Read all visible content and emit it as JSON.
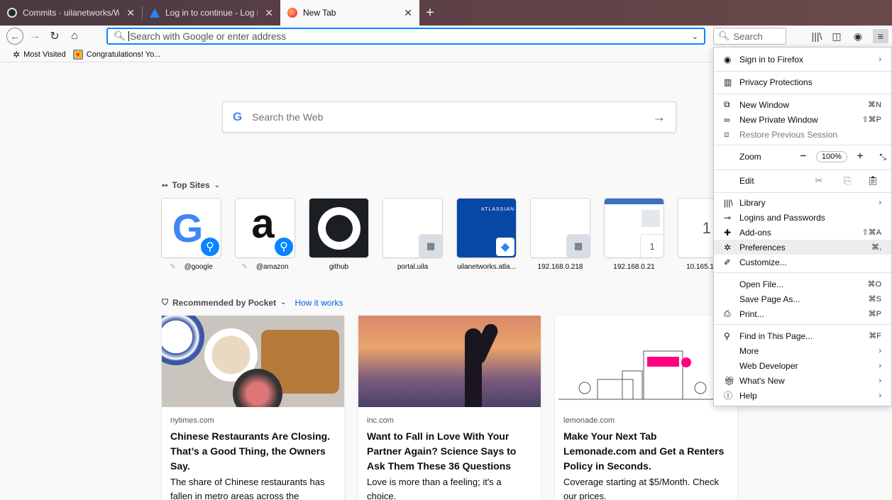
{
  "tabs": [
    {
      "label": "Commits · uilanetworks/Web",
      "icon_color": "#24292e"
    },
    {
      "label": "Log in to continue - Log in with Atlassian account",
      "icon_color": "#2684ff"
    },
    {
      "label": "New Tab",
      "icon_color": "#ff7139"
    }
  ],
  "urlbar": {
    "placeholder": "Search with Google or enter address"
  },
  "searchbar": {
    "placeholder": "Search"
  },
  "bookmarks": [
    {
      "label": "Most Visited"
    },
    {
      "label": "Congratulations! Yo..."
    }
  ],
  "websearch": {
    "logo": "G",
    "placeholder": "Search the Web"
  },
  "top_sites": {
    "title": "Top Sites",
    "tiles": [
      {
        "label": "@google",
        "pinned": true
      },
      {
        "label": "@amazon",
        "pinned": true
      },
      {
        "label": "github"
      },
      {
        "label": "portal.uila"
      },
      {
        "label": "uilanetworks.atla...",
        "thumb_text": "ATLASSIAN"
      },
      {
        "label": "192.168.0.218"
      },
      {
        "label": "192.168.0.21",
        "badge": "1"
      },
      {
        "label": "10.165.1",
        "badge": "1"
      }
    ]
  },
  "pocket": {
    "title": "Recommended by Pocket",
    "link": "How it works",
    "cards": [
      {
        "source": "nytimes.com",
        "headline": "Chinese Restaurants Are Closing. That’s a Good Thing, the Owners Say.",
        "desc": "The share of Chinese restaurants has fallen in metro areas across the"
      },
      {
        "source": "inc.com",
        "headline": "Want to Fall in Love With Your Partner Again? Science Says to Ask Them These 36 Questions",
        "desc": "Love is more than a feeling; it's a choice."
      },
      {
        "source": "lemonade.com",
        "headline": "Make Your Next Tab Lemonade.com and Get a Renters Policy in Seconds.",
        "desc": "Coverage starting at $5/Month. Check our prices."
      }
    ]
  },
  "menu": {
    "sign_in": "Sign in to Firefox",
    "privacy": "Privacy Protections",
    "new_window": "New Window",
    "new_window_key": "⌘N",
    "new_private": "New Private Window",
    "new_private_key": "⇧⌘P",
    "restore": "Restore Previous Session",
    "zoom": "Zoom",
    "zoom_value": "100%",
    "edit": "Edit",
    "library": "Library",
    "logins": "Logins and Passwords",
    "addons": "Add-ons",
    "addons_key": "⇧⌘A",
    "preferences": "Preferences",
    "preferences_key": "⌘,",
    "customize": "Customize...",
    "open_file": "Open File...",
    "open_file_key": "⌘O",
    "save_page": "Save Page As...",
    "save_page_key": "⌘S",
    "print": "Print...",
    "print_key": "⌘P",
    "find": "Find in This Page...",
    "find_key": "⌘F",
    "more": "More",
    "web_dev": "Web Developer",
    "whats_new": "What's New",
    "help": "Help"
  }
}
